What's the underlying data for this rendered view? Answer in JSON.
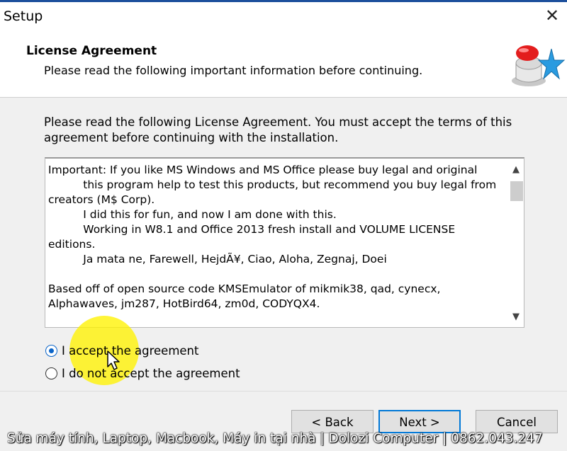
{
  "window": {
    "title": "Setup",
    "close_glyph": "✕"
  },
  "header": {
    "title": "License Agreement",
    "subtitle": "Please read the following important information before continuing.",
    "icon": "setup-wizard-icon"
  },
  "intro_text": "Please read the following License Agreement. You must accept the terms of this agreement before continuing with the installation.",
  "license_text": "Important: If you like MS Windows and MS Office please buy legal and original\n          this program help to test this products, but recommend you buy legal from\ncreators (M$ Corp).\n          I did this for fun, and now I am done with this.\n          Working in W8.1 and Office 2013 fresh install and VOLUME LICENSE\neditions.\n          Ja mata ne, Farewell, HejdÃ¥, Ciao, Aloha, Zegnaj, Doei\n\nBased off of open source code KMSEmulator of mikmik38, qad, cynecx,\nAlphawaves, jm287, HotBird64, zm0d, CODYQX4.",
  "options": {
    "accept_label": "I accept the agreement",
    "decline_label": "I do not accept the agreement",
    "selected": "accept"
  },
  "buttons": {
    "back": "< Back",
    "next": "Next >",
    "cancel": "Cancel"
  },
  "watermark": "Sửa máy tính, Laptop, Macbook, Máy in tại nhà | Dolozi Computer | 0862.043.247",
  "colors": {
    "accent": "#0078d7",
    "radio_selected": "#0a64c8",
    "highlight": "#fff200"
  }
}
